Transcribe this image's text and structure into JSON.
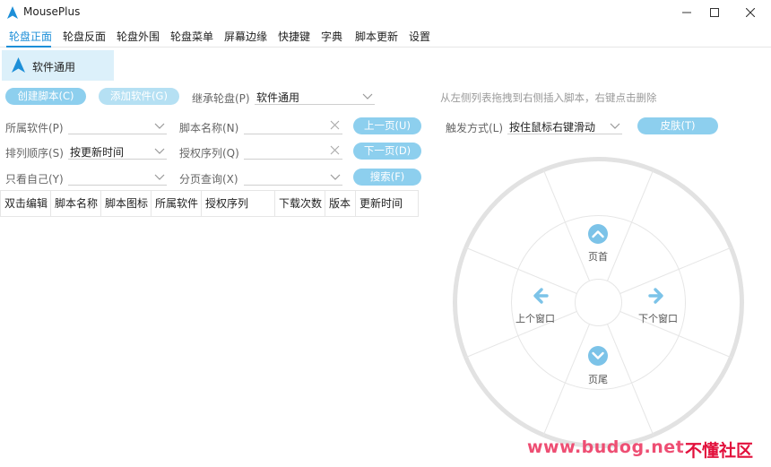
{
  "app": {
    "title": "MousePlus",
    "accent_color": "#1d8fd8",
    "button_color": "#8dcfee"
  },
  "window": {
    "minimize_icon": "minimize-icon",
    "maximize_icon": "maximize-icon",
    "close_icon": "close-icon"
  },
  "menu": {
    "tabs": [
      {
        "label": "轮盘正面",
        "active": true
      },
      {
        "label": "轮盘反面"
      },
      {
        "label": "轮盘外围"
      },
      {
        "label": "轮盘菜单"
      },
      {
        "label": "屏幕边缘"
      },
      {
        "label": "快捷键"
      },
      {
        "label": "字典"
      },
      {
        "label": "脚本更新"
      },
      {
        "label": "设置"
      }
    ]
  },
  "wheel_list": {
    "selected": "软件通用"
  },
  "toolbar": {
    "create_label": "创建脚本(C)",
    "add_software_label": "添加软件(G)",
    "inherit_label": "继承轮盘(P)",
    "inherit_value": "软件通用",
    "hint": "从左侧列表拖拽到右侧插入脚本，右键点击删除"
  },
  "filters": {
    "software_label": "所属软件(P)",
    "software_value": "",
    "script_name_label": "脚本名称(N)",
    "script_name_value": "",
    "prev_label": "上一页(U)",
    "sort_label": "排列顺序(S)",
    "sort_value": "按更新时间",
    "license_label": "授权序列(Q)",
    "license_value": "",
    "next_label": "下一页(D)",
    "mine_label": "只看自己(Y)",
    "mine_value": "",
    "page_label": "分页查询(X)",
    "page_value": "",
    "search_label": "搜索(F)"
  },
  "trigger": {
    "label": "触发方式(L)",
    "value": "按住鼠标右键滑动",
    "skin_label": "皮肤(T)"
  },
  "table": {
    "columns": [
      "双击编辑",
      "脚本名称",
      "脚本图标",
      "所属软件",
      "授权序列",
      "下载次数",
      "版本",
      "更新时间"
    ]
  },
  "wheel": {
    "top_label": "页首",
    "left_label": "上个窗口",
    "right_label": "下个窗口",
    "bottom_label": "页尾"
  },
  "watermark": {
    "url": "www.budog.net",
    "name": "不懂社区"
  }
}
